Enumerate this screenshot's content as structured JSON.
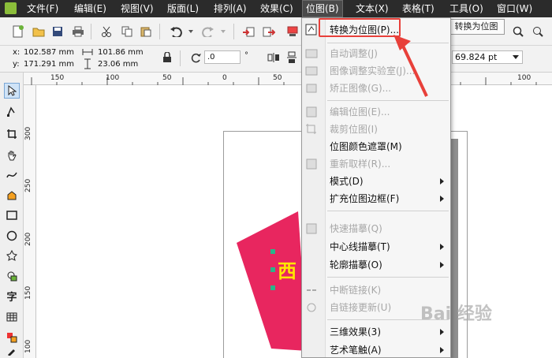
{
  "menubar": {
    "items": [
      {
        "label": "文件(F)"
      },
      {
        "label": "编辑(E)"
      },
      {
        "label": "视图(V)"
      },
      {
        "label": "版面(L)"
      },
      {
        "label": "排列(A)"
      },
      {
        "label": "效果(C)"
      },
      {
        "label": "位图(B)"
      },
      {
        "label": "文本(X)"
      },
      {
        "label": "表格(T)"
      },
      {
        "label": "工具(O)"
      },
      {
        "label": "窗口(W)"
      }
    ]
  },
  "tooltip": "转换为位图",
  "propbar": {
    "x_label": "x:",
    "x_value": "102.587 mm",
    "y_label": "y:",
    "y_value": "171.291 mm",
    "width_value": "101.86 mm",
    "height_value": "23.06 mm",
    "angle_value": ".0",
    "angle_unit": "°",
    "outline_value": "69.824 pt"
  },
  "ruler": {
    "top_labels": [
      "150",
      "100",
      "50",
      "0",
      "50",
      "100"
    ],
    "left_labels": [
      "300",
      "250",
      "200",
      "150",
      "100"
    ]
  },
  "canvas": {
    "shape_text": "西",
    "shape_color": "#e8265f",
    "text_color": "#ffe600"
  },
  "dropdown": {
    "items": [
      {
        "label": "转换为位图(P)...",
        "enabled": true,
        "submenu": false
      },
      {
        "label": "自动调整(J)",
        "enabled": false,
        "submenu": false
      },
      {
        "label": "图像调整实验室(J)...",
        "enabled": false,
        "submenu": false
      },
      {
        "label": "矫正图像(G)...",
        "enabled": false,
        "submenu": false
      },
      {
        "label": "编辑位图(E)...",
        "enabled": false,
        "submenu": false
      },
      {
        "label": "裁剪位图(I)",
        "enabled": false,
        "submenu": false
      },
      {
        "label": "位图颜色遮罩(M)",
        "enabled": true,
        "submenu": false
      },
      {
        "label": "重新取样(R)...",
        "enabled": false,
        "submenu": false
      },
      {
        "label": "模式(D)",
        "enabled": true,
        "submenu": true
      },
      {
        "label": "扩充位图边框(F)",
        "enabled": true,
        "submenu": true
      },
      {
        "label": "快速描摹(Q)",
        "enabled": false,
        "submenu": false
      },
      {
        "label": "中心线描摹(T)",
        "enabled": true,
        "submenu": true
      },
      {
        "label": "轮廓描摹(O)",
        "enabled": true,
        "submenu": true
      },
      {
        "label": "中断链接(K)",
        "enabled": false,
        "submenu": false
      },
      {
        "label": "自链接更新(U)",
        "enabled": false,
        "submenu": false
      },
      {
        "label": "三维效果(3)",
        "enabled": true,
        "submenu": true
      },
      {
        "label": "艺术笔触(A)",
        "enabled": true,
        "submenu": true
      }
    ]
  },
  "toolbox": {
    "text_tool_glyph": "字"
  },
  "watermark": "Bai 经验",
  "colors": {
    "menubar_bg": "#2b2b2b",
    "highlight": "#e8403a"
  }
}
